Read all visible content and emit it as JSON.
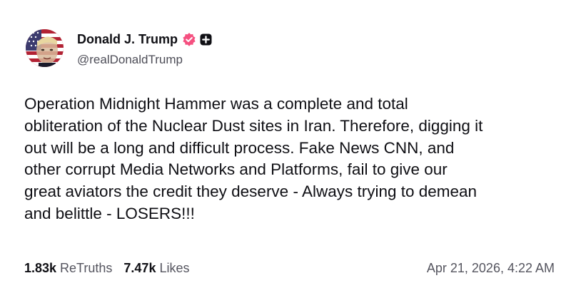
{
  "author": {
    "display_name": "Donald J. Trump",
    "handle": "@realDonaldTrump",
    "verified_color": "#f55080"
  },
  "post": {
    "lines": [
      "Operation Midnight Hammer was a complete and total",
      "obliteration of the Nuclear Dust sites in Iran. Therefore, digging it",
      "out will be a long and difficult process. Fake News CNN, and",
      "other corrupt Media Networks and Platforms, fail to give our",
      "great aviators the credit they deserve - Always trying to demean",
      "and belittle - LOSERS!!!"
    ]
  },
  "stats": {
    "retruths_count": "1.83k",
    "retruths_label": "ReTruths",
    "likes_count": "7.47k",
    "likes_label": "Likes"
  },
  "timestamp": "Apr 21, 2026, 4:22 AM",
  "icons": {
    "avatar": "profile-avatar",
    "verified": "verified-badge-icon",
    "plus": "plus-badge-icon"
  }
}
